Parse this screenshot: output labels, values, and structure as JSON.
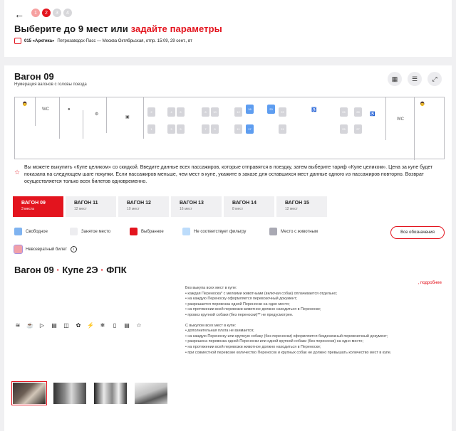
{
  "header": {
    "back_icon": "arrow-left-icon",
    "steps": [
      "1",
      "2",
      "3",
      "4"
    ],
    "title": "Выберите до 9 мест или",
    "title_link": "задайте параметры",
    "train_number": "015 «Арктика»",
    "train_route": "Петрозаводск-Пасс — Москва Октябрьская, отпр. 15:09, 29 сент., вт"
  },
  "wagon": {
    "title": "Вагон 09",
    "subtitle": "Нумерация вагонов с головы поезда",
    "map_labels": {
      "wc_left": "WC",
      "wc_right": "WC"
    },
    "seats_top": [
      "2",
      "4",
      "6",
      "8",
      "10",
      "12",
      "14",
      "16",
      "18",
      "20",
      "22",
      "24",
      "26",
      "28"
    ],
    "seats_bottom": [
      "1",
      "3",
      "5",
      "7",
      "9",
      "11",
      "13",
      "15",
      "17",
      "19",
      "21",
      "23",
      "25",
      "27"
    ],
    "selected_seats": [
      "18",
      "20",
      "17"
    ]
  },
  "notice": "Вы можете выкупить «Купе целиком» со скидкой. Введите данные всех пассажиров, которые отправятся в поездку, затем выберите тариф «Купе целиком». Цена за купе будет показана на следующем шаге покупки. Если пассажиров меньше, чем мест в купе, укажите в заказе для оставшихся мест данные одного из пассажиров повторно. Возврат осуществляется только всех билетов одновременно.",
  "tabs": [
    {
      "name": "ВАГОН 09",
      "count": "3 места"
    },
    {
      "name": "ВАГОН 11",
      "count": "12 мест"
    },
    {
      "name": "ВАГОН 12",
      "count": "10 мест"
    },
    {
      "name": "ВАГОН 13",
      "count": "16 мест"
    },
    {
      "name": "ВАГОН 14",
      "count": "8 мест"
    },
    {
      "name": "ВАГОН 15",
      "count": "12 мест"
    }
  ],
  "legend": {
    "free": "Свободное",
    "taken": "Занятое место",
    "selected": "Выбранное",
    "filter": "Не соответствует фильтру",
    "pet": "Место с животным",
    "all_button": "Все обозначения",
    "nonrefund": "Невозвратный билет",
    "colors": {
      "free": "#7fb3f0",
      "taken": "#ededf0",
      "selected": "#e3141e",
      "filter": "#bcdcfb",
      "pet": "#a9a9b3",
      "nonrefund": "#f2a0a8"
    }
  },
  "coupe": {
    "wagon": "Вагон 09",
    "coupe": "Купе 2Э",
    "carrier": "ФПК",
    "more_link": ", подробнее"
  },
  "rules": [
    "Без выкупа всех мест в купе:",
    "• каждая Переноска* с мелкими животными (включая собак) оплачивается отдельно;",
    "• на каждую Переноску оформляется перевозочный документ;",
    "• разрешается перевозка одной Переноски на одно место;",
    "• на протяжении всей перевозки животное должно находиться в Переноске;",
    "• провоз крупной собаки (без переноски)** не предусмотрен.",
    "",
    "С выкупом всех мест в купе:",
    "• дополнительная плата не взимается;",
    "• на каждую Переноску или крупную собаку (без переноски) оформляется безденежный перевозочный документ;",
    "• разрешена перевозка одной Переноски или одной крупной собаки (без переноски) на одно место;",
    "• на протяжении всей перевозки животное должно находиться в Переноске;",
    "• при совместной перевозке количество Переносок и крупных собак не должно превышать количество мест в купе."
  ],
  "amenities": [
    "wifi-icon",
    "cup-icon",
    "tv-icon",
    "bed-icon",
    "towel-icon",
    "pet-icon",
    "socket-icon",
    "climate-icon",
    "hygiene-icon",
    "press-icon",
    "star-icon"
  ]
}
